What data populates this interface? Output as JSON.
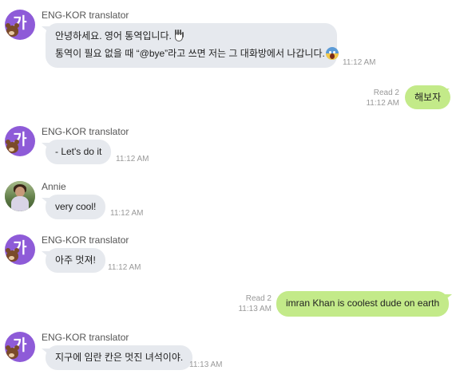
{
  "messages": [
    {
      "sender": "ENG-KOR translator",
      "line1": "안녕하세요. 영어 통역입니다.",
      "line2": "통역이 필요 없을 때 “@bye”라고 쓰면 저는 그 대화방에서 나갑니다.",
      "emoji1": "waving-hand-icon",
      "emoji2": "screaming-face-icon",
      "time": "11:12 AM"
    },
    {
      "text": "해보자",
      "read": "Read 2",
      "time": "11:12 AM"
    },
    {
      "sender": "ENG-KOR translator",
      "text": "- Let's do it",
      "time": "11:12 AM"
    },
    {
      "sender": "Annie",
      "text": "very cool!",
      "time": "11:12 AM"
    },
    {
      "sender": "ENG-KOR translator",
      "text": "아주 멋져!",
      "time": "11:12 AM"
    },
    {
      "text": "imran Khan is coolest dude on earth",
      "read": "Read 2",
      "time": "11:13 AM"
    },
    {
      "sender": "ENG-KOR translator",
      "text": "지구에 임란 칸은 멋진 녀석이야.",
      "time": "11:13 AM"
    }
  ],
  "avatar": {
    "bot_glyph": "가",
    "bot_color": "#8e5bd8"
  },
  "colors": {
    "incoming_bubble": "#e6e9ee",
    "outgoing_bubble": "#c3ea89"
  }
}
